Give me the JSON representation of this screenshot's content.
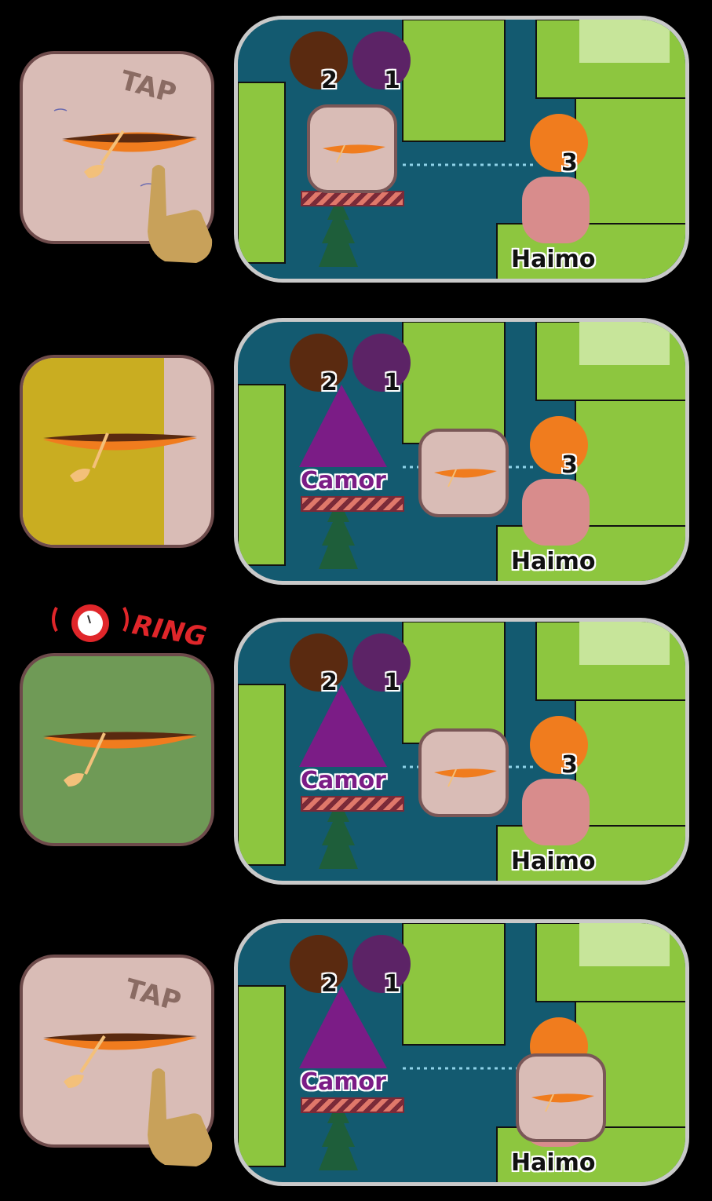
{
  "screen": {
    "title": ""
  },
  "labels": {
    "tap": "TAP",
    "ring": "RING",
    "camor": "Camor",
    "haimo": "Haimo"
  },
  "counts": {
    "wood": "2",
    "berry": "1",
    "bee": "3"
  },
  "colors": {
    "button_default": "#d9bcb6",
    "button_progress": "#c9ad21",
    "button_ready": "#6f9a56",
    "grass": "#8dc63f",
    "water": "#135a70",
    "camor": "#7b1c86",
    "ring": "#e0262a"
  },
  "panels": [
    {
      "step": "tap-start",
      "button_state": "idle",
      "show_camor_text": false
    },
    {
      "step": "charging",
      "button_state": "progress",
      "progress_fraction": 0.75
    },
    {
      "step": "alarm",
      "button_state": "ready"
    },
    {
      "step": "tap-again",
      "button_state": "idle"
    }
  ],
  "icons": {
    "dig": "shovel-dig-icon",
    "wood": "wood-log-icon",
    "berry": "berry-icon",
    "bee": "bee-icon",
    "alarm": "alarm-clock-icon",
    "hand": "pointing-hand-icon"
  }
}
